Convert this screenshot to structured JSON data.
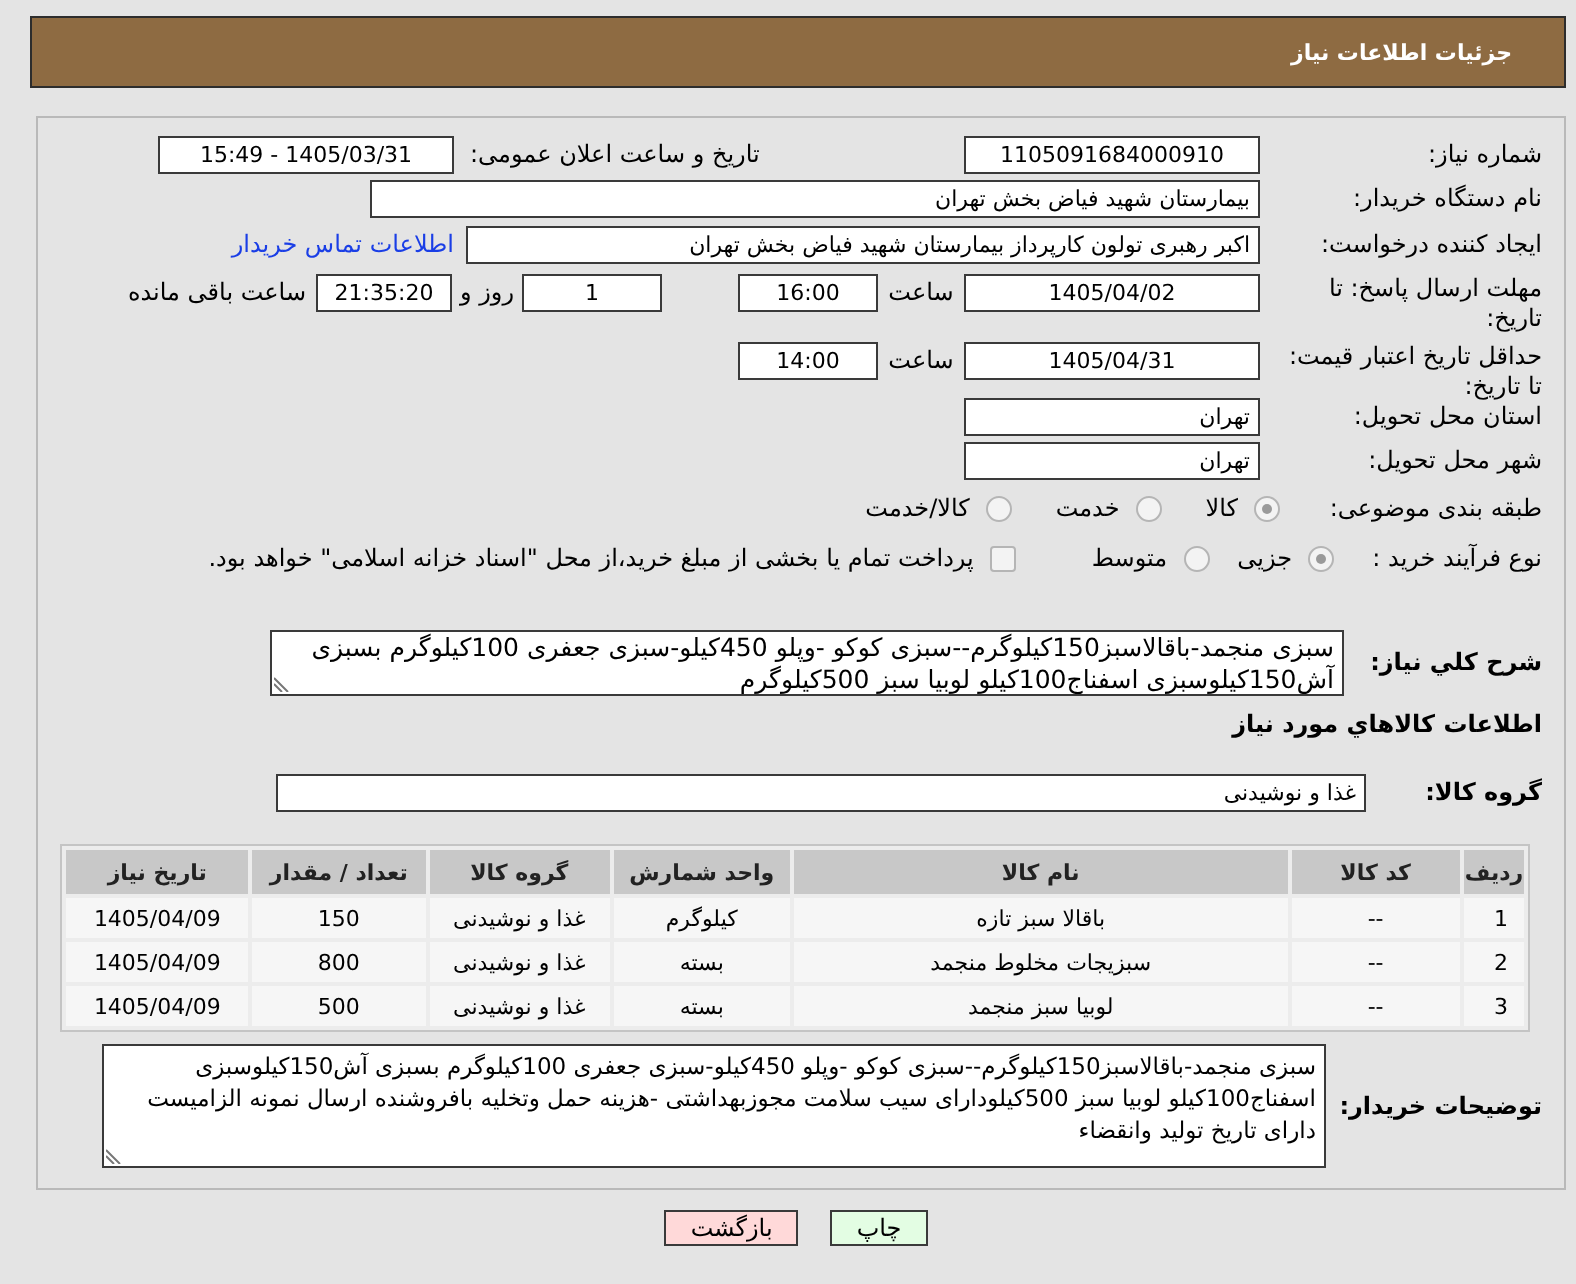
{
  "header": {
    "title": "جزئیات اطلاعات نیاز"
  },
  "form": {
    "need_number": {
      "label": "شماره نیاز:",
      "value": "1105091684000910"
    },
    "announce_datetime": {
      "label": "تاریخ و ساعت اعلان عمومی:",
      "value": "1405/03/31 - 15:49"
    },
    "buyer_org": {
      "label": "نام دستگاه خریدار:",
      "value": "بیمارستان شهید فیاض بخش تهران"
    },
    "requester": {
      "label": "ایجاد کننده درخواست:",
      "value": "اکبر رهبری تولون کارپرداز بیمارستان شهید فیاض بخش تهران",
      "link": "اطلاعات تماس خریدار"
    },
    "reply_deadline": {
      "label": "مهلت ارسال پاسخ: تا تاریخ:",
      "date": "1405/04/02",
      "time_label": "ساعت",
      "time": "16:00",
      "days": "1",
      "days_label": "روز و",
      "remaining": "21:35:20",
      "remaining_label": "ساعت باقی مانده"
    },
    "price_validity": {
      "label": "حداقل تاریخ اعتبار قیمت: تا تاریخ:",
      "date": "1405/04/31",
      "time_label": "ساعت",
      "time": "14:00"
    },
    "province": {
      "label": "استان محل تحویل:",
      "value": "تهران"
    },
    "city": {
      "label": "شهر محل تحویل:",
      "value": "تهران"
    },
    "category": {
      "label": "طبقه بندی موضوعی:",
      "options": [
        {
          "label": "کالا",
          "selected": true
        },
        {
          "label": "خدمت",
          "selected": false
        },
        {
          "label": "کالا/خدمت",
          "selected": false
        }
      ]
    },
    "process_type": {
      "label": "نوع فرآیند خرید :",
      "options": [
        {
          "label": "جزیی",
          "selected": true
        },
        {
          "label": "متوسط",
          "selected": false
        }
      ],
      "treasury": {
        "label": "پرداخت تمام یا بخشی از مبلغ خرید،از محل \"اسناد خزانه اسلامی\" خواهد بود.",
        "checked": false
      }
    },
    "description": {
      "label": "شرح کلي نياز:",
      "value": "سبزی منجمد-باقالاسبز150کیلوگرم--سبزی کوکو -وپلو 450کیلو-سبزی جعفری 100کیلوگرم بسبزی آش150کیلوسبزی اسفناج100کیلو لوبیا سبز 500کیلوگرم"
    }
  },
  "goods": {
    "title": "اطلاعات کالاهاي مورد نياز",
    "group": {
      "label": "گروه کالا:",
      "value": "غذا و نوشیدنی"
    },
    "table": {
      "columns": [
        "ردیف",
        "کد کالا",
        "نام کالا",
        "واحد شمارش",
        "گروه کالا",
        "تعداد / مقدار",
        "تاریخ نیاز"
      ],
      "rows": [
        [
          "1",
          "--",
          "باقالا سبز تازه",
          "کیلوگرم",
          "غذا و نوشیدنی",
          "150",
          "1405/04/09"
        ],
        [
          "2",
          "--",
          "سبزیجات مخلوط منجمد",
          "بسته",
          "غذا و نوشیدنی",
          "800",
          "1405/04/09"
        ],
        [
          "3",
          "--",
          "لوبیا سبز منجمد",
          "بسته",
          "غذا و نوشیدنی",
          "500",
          "1405/04/09"
        ]
      ]
    }
  },
  "buyer_notes": {
    "label": "توضیحات خریدار:",
    "value": "سبزی منجمد-باقالاسبز150کیلوگرم--سبزی کوکو -وپلو 450کیلو-سبزی جعفری 100کیلوگرم بسبزی آش150کیلوسبزی اسفناج100کیلو لوبیا سبز 500کیلودارای سیب سلامت مجوزبهداشتی -هزینه حمل وتخلیه بافروشنده ارسال نمونه الزامیست دارای تاریخ تولید وانقضاء"
  },
  "buttons": [
    {
      "label": "چاپ",
      "kind": "print"
    },
    {
      "label": "بازگشت",
      "kind": "back"
    }
  ]
}
